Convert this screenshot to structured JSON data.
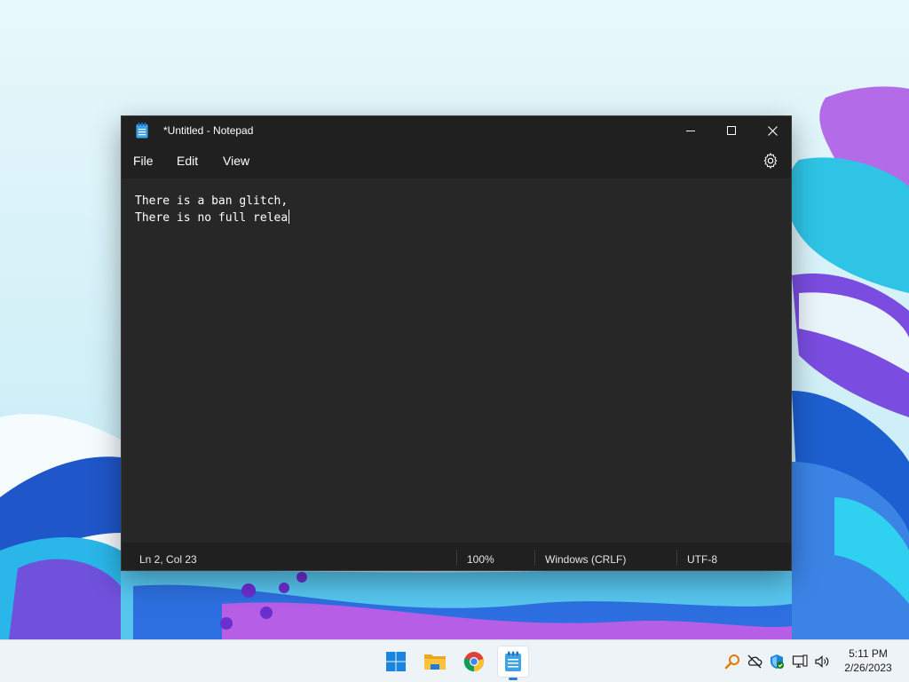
{
  "window": {
    "title": "*Untitled - Notepad"
  },
  "menu": {
    "file": "File",
    "edit": "Edit",
    "view": "View"
  },
  "editor": {
    "lines": [
      "There is a ban glitch,",
      "There is no full relea"
    ]
  },
  "status": {
    "position": "Ln 2, Col 23",
    "zoom": "100%",
    "line_ending": "Windows (CRLF)",
    "encoding": "UTF-8"
  },
  "taskbar": {
    "apps": [
      "start-icon",
      "file-explorer-icon",
      "chrome-icon",
      "notepad-icon"
    ]
  },
  "tray": {
    "icons": [
      "search-tool-icon",
      "onedrive-icon",
      "security-icon",
      "network-icon",
      "volume-icon"
    ],
    "time": "5:11 PM",
    "date": "2/26/2023"
  },
  "colors": {
    "window_bg": "#272727",
    "titlebar_bg": "#202020",
    "accent": "#2a7fd8"
  }
}
